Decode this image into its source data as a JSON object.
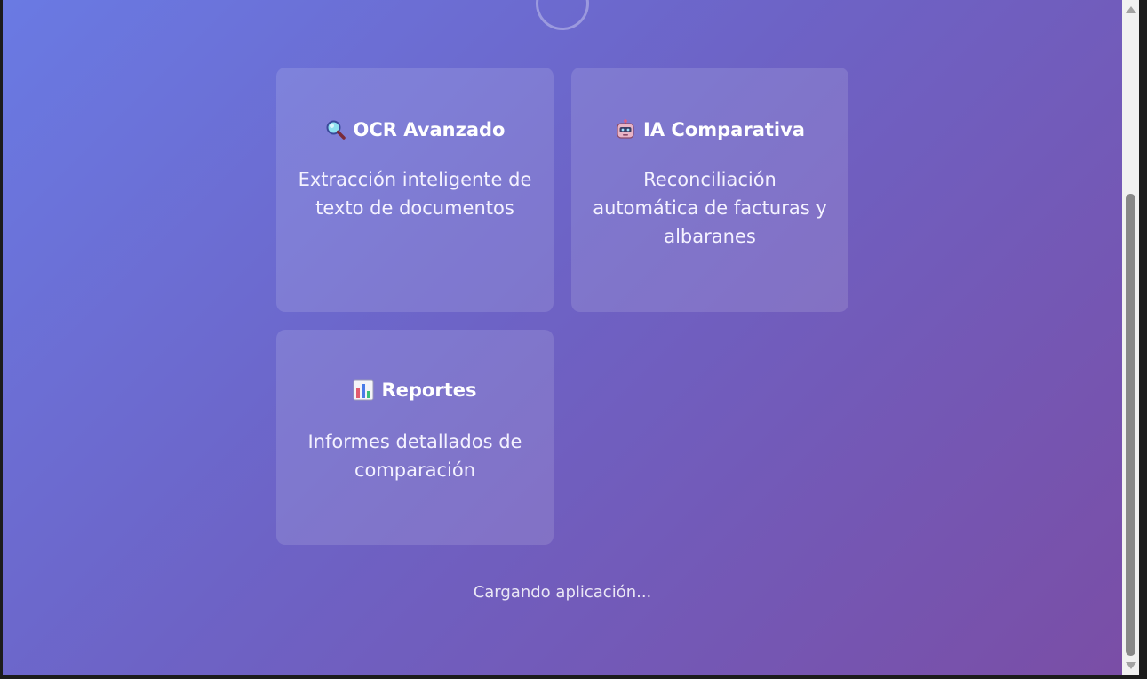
{
  "cards": [
    {
      "title": "OCR Avanzado",
      "icon": "magnifier-icon",
      "description": "Extracción inteligente de texto de documentos"
    },
    {
      "title": "IA Comparativa",
      "icon": "robot-icon",
      "description": "Reconciliación automática de facturas y albaranes"
    },
    {
      "title": "Reportes",
      "icon": "bar-chart-icon",
      "description": "Informes detallados de comparación"
    }
  ],
  "footer": {
    "loading_text": "Cargando aplicación..."
  },
  "colors": {
    "gradient_start": "#6a7ae3",
    "gradient_end": "#7a4ea6"
  }
}
